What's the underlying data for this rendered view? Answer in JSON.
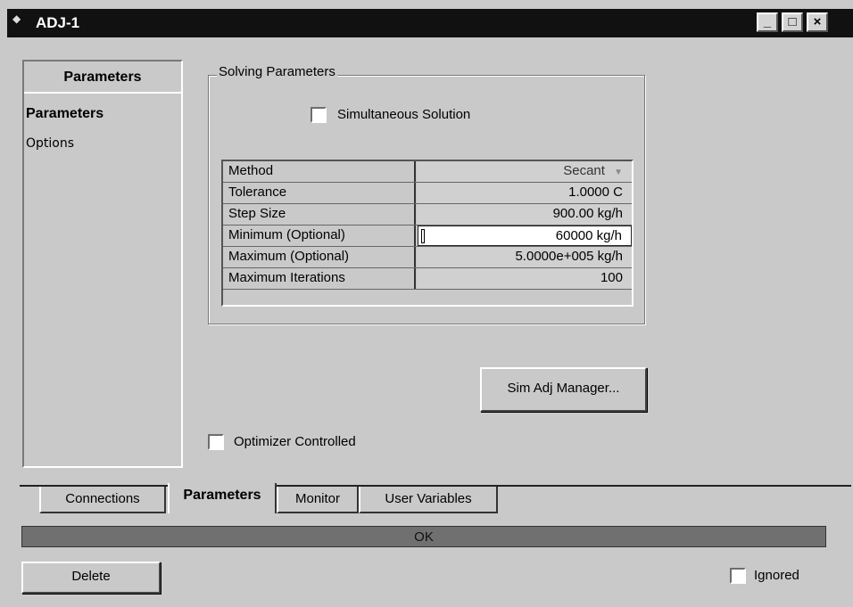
{
  "window": {
    "title": "ADJ-1",
    "controls": {
      "minimize": "_",
      "maximize": "□",
      "close": "×"
    }
  },
  "nav": {
    "header": "Parameters",
    "items": [
      {
        "label": "Parameters",
        "selected": true
      },
      {
        "label": "Options",
        "selected": false
      }
    ]
  },
  "solving": {
    "group_label": "Solving Parameters",
    "simultaneous_label": "Simultaneous Solution",
    "simultaneous_checked": false
  },
  "params_table": [
    {
      "name": "Method",
      "value": "Secant",
      "dropdown": true
    },
    {
      "name": "Tolerance",
      "value": "1.0000 C"
    },
    {
      "name": "Step Size",
      "value": "900.00 kg/h"
    },
    {
      "name": "Minimum (Optional)",
      "value": "60000 kg/h",
      "highlighted": true
    },
    {
      "name": "Maximum (Optional)",
      "value": "5.0000e+005 kg/h"
    },
    {
      "name": "Maximum Iterations",
      "value": "100"
    }
  ],
  "sim_adj_button": "Sim Adj Manager...",
  "optimizer": {
    "label": "Optimizer Controlled",
    "checked": false
  },
  "tabs": [
    {
      "label": "Connections",
      "active": false
    },
    {
      "label": "Parameters",
      "active": true
    },
    {
      "label": "Monitor",
      "active": false
    },
    {
      "label": "User Variables",
      "active": false
    }
  ],
  "status": {
    "text": "OK"
  },
  "delete_button": "Delete",
  "ignored": {
    "label": "Ignored",
    "checked": false
  },
  "colors": {
    "background": "#c9c9c9",
    "titlebar": "#111111",
    "status_bar": "#707070"
  }
}
